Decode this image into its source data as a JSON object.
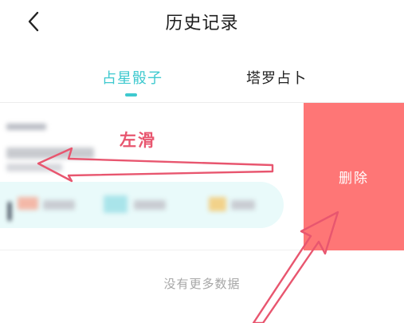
{
  "header": {
    "title": "历史记录",
    "back_icon": "chevron-left-icon"
  },
  "tabs": [
    {
      "label": "占星骰子",
      "active": true
    },
    {
      "label": "塔罗占卜",
      "active": false
    }
  ],
  "colors": {
    "accent": "#3ec9cf",
    "delete": "#fe7676",
    "annotation": "#e8566f"
  },
  "record_actions": {
    "delete_label": "删除"
  },
  "annotation": {
    "label": "左滑"
  },
  "footer": {
    "no_more_text": "没有更多数据"
  }
}
